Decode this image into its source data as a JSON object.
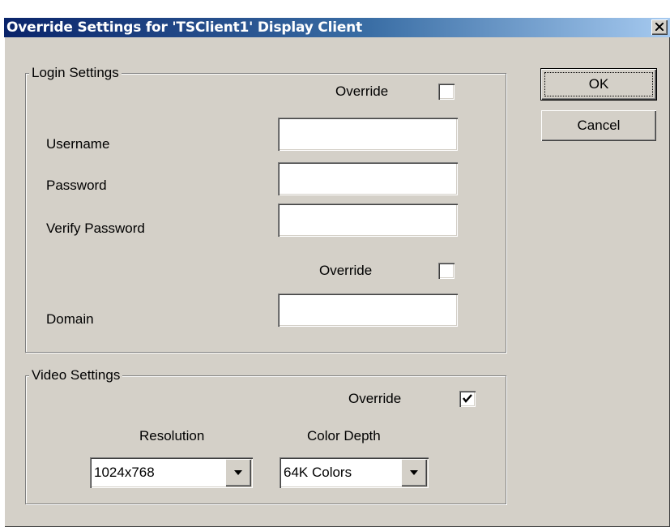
{
  "window": {
    "title": "Override Settings for 'TSClient1' Display Client"
  },
  "buttons": {
    "ok": "OK",
    "cancel": "Cancel"
  },
  "login_settings": {
    "legend": "Login Settings",
    "override_label_1": "Override",
    "override_1_checked": false,
    "username_label": "Username",
    "username_value": "",
    "password_label": "Password",
    "password_value": "",
    "verify_password_label": "Verify Password",
    "verify_password_value": "",
    "override_label_2": "Override",
    "override_2_checked": false,
    "domain_label": "Domain",
    "domain_value": ""
  },
  "video_settings": {
    "legend": "Video Settings",
    "override_label": "Override",
    "override_checked": true,
    "resolution_label": "Resolution",
    "resolution_value": "1024x768",
    "color_depth_label": "Color Depth",
    "color_depth_value": "64K Colors"
  },
  "icons": {
    "close": "close-icon",
    "check": "checkmark-icon",
    "dropdown": "dropdown-arrow-icon"
  }
}
